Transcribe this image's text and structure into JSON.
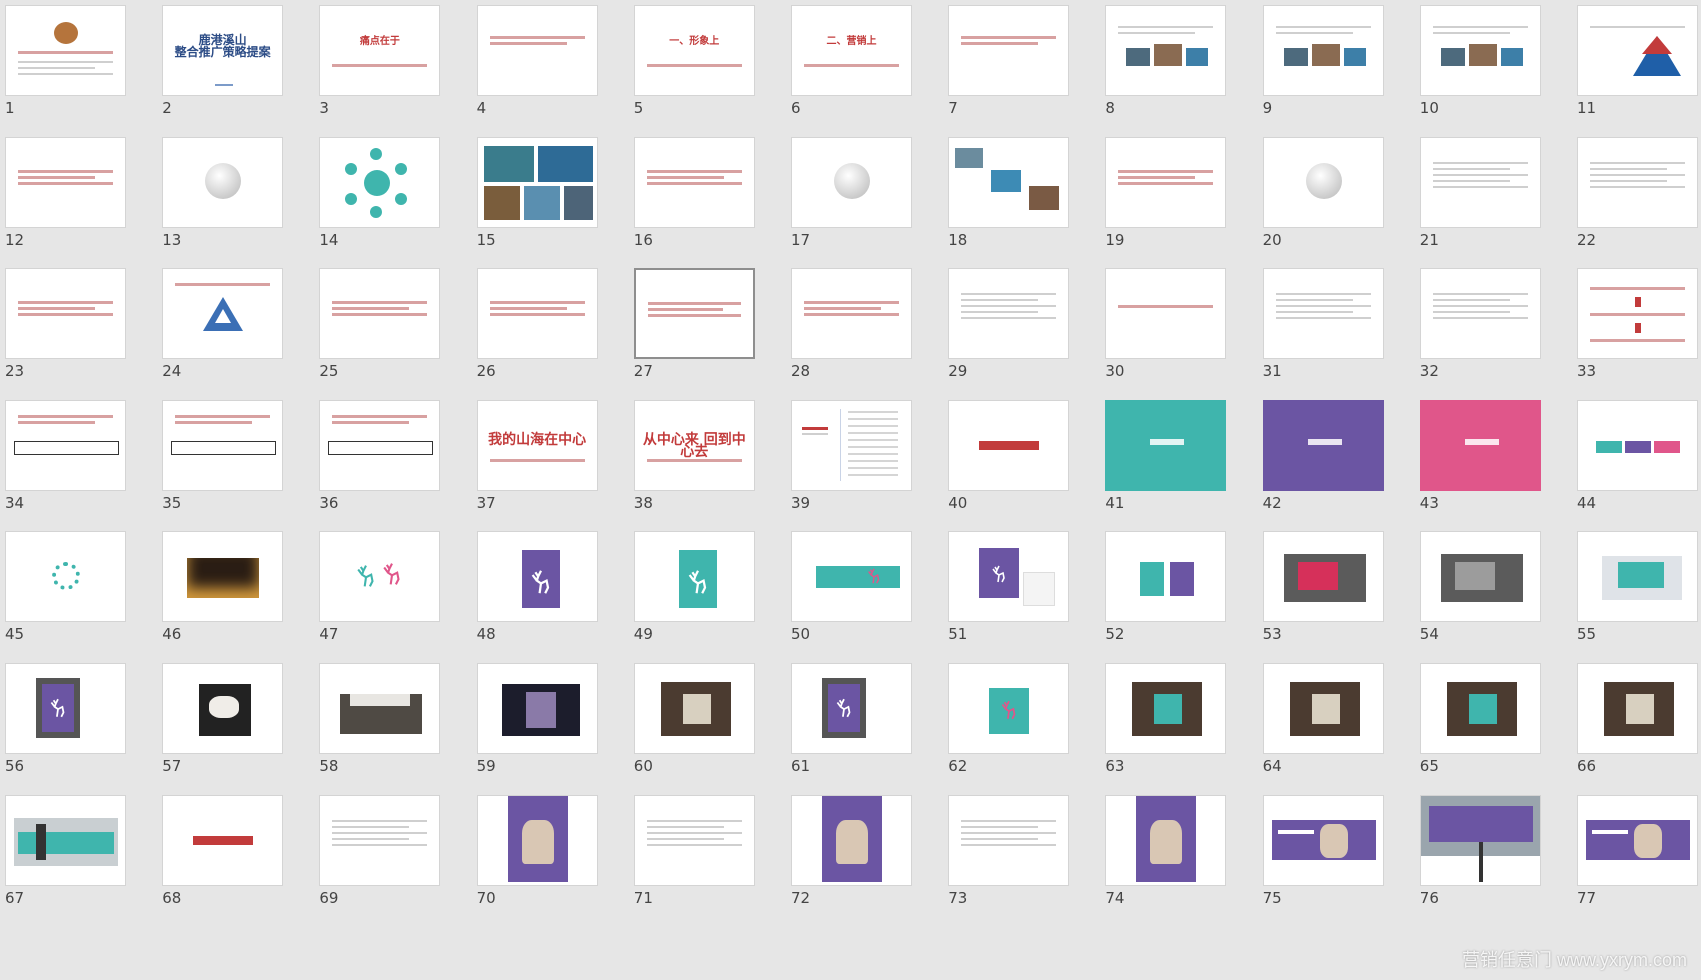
{
  "colors": {
    "background": "#e6e6e6",
    "accent_red": "#c23b3b",
    "teal": "#3fb5ad",
    "purple": "#6b55a3",
    "pink": "#e0568a",
    "selection_border": "#8e8e8e"
  },
  "slides": {
    "columns": 11,
    "selected": 27,
    "items": [
      {
        "n": 1,
        "kind": "logo"
      },
      {
        "n": 2,
        "kind": "title-navy",
        "title": "鹿港溪山\n整合推广策略提案"
      },
      {
        "n": 3,
        "kind": "title",
        "title": "痛点在于"
      },
      {
        "n": 4,
        "kind": "title"
      },
      {
        "n": 5,
        "kind": "title",
        "title": "一、形象上"
      },
      {
        "n": 6,
        "kind": "title",
        "title": "二、营销上"
      },
      {
        "n": 7,
        "kind": "title"
      },
      {
        "n": 8,
        "kind": "photos-text"
      },
      {
        "n": 9,
        "kind": "photos-text"
      },
      {
        "n": 10,
        "kind": "photos-text"
      },
      {
        "n": 11,
        "kind": "pyramid"
      },
      {
        "n": 12,
        "kind": "text-red"
      },
      {
        "n": 13,
        "kind": "circle-gray"
      },
      {
        "n": 14,
        "kind": "network"
      },
      {
        "n": 15,
        "kind": "photo-grid"
      },
      {
        "n": 16,
        "kind": "text-red"
      },
      {
        "n": 17,
        "kind": "circle-gray"
      },
      {
        "n": 18,
        "kind": "photo-scatter"
      },
      {
        "n": 19,
        "kind": "text-red"
      },
      {
        "n": 20,
        "kind": "circle-gray"
      },
      {
        "n": 21,
        "kind": "text-gray"
      },
      {
        "n": 22,
        "kind": "text-gray"
      },
      {
        "n": 23,
        "kind": "text-red"
      },
      {
        "n": 24,
        "kind": "triangle"
      },
      {
        "n": 25,
        "kind": "text-red"
      },
      {
        "n": 26,
        "kind": "text-red"
      },
      {
        "n": 27,
        "kind": "text-red"
      },
      {
        "n": 28,
        "kind": "text-red"
      },
      {
        "n": 29,
        "kind": "text-gray"
      },
      {
        "n": 30,
        "kind": "text-red-short"
      },
      {
        "n": 31,
        "kind": "text-gray"
      },
      {
        "n": 32,
        "kind": "text-gray"
      },
      {
        "n": 33,
        "kind": "arrows"
      },
      {
        "n": 34,
        "kind": "boxed"
      },
      {
        "n": 35,
        "kind": "boxed"
      },
      {
        "n": 36,
        "kind": "boxed"
      },
      {
        "n": 37,
        "kind": "title",
        "title": "我的山海在中心"
      },
      {
        "n": 38,
        "kind": "title",
        "title": "从中心来 回到中心去"
      },
      {
        "n": 39,
        "kind": "columns"
      },
      {
        "n": 40,
        "kind": "bar-red"
      },
      {
        "n": 41,
        "kind": "solid",
        "color": "#3fb5ad"
      },
      {
        "n": 42,
        "kind": "solid",
        "color": "#6b55a3"
      },
      {
        "n": 43,
        "kind": "solid",
        "color": "#e0568a"
      },
      {
        "n": 44,
        "kind": "swatches"
      },
      {
        "n": 45,
        "kind": "emblem"
      },
      {
        "n": 46,
        "kind": "photo-night"
      },
      {
        "n": 47,
        "kind": "deer-pair"
      },
      {
        "n": 48,
        "kind": "poster",
        "color": "#6b55a3"
      },
      {
        "n": 49,
        "kind": "poster",
        "color": "#3fb5ad"
      },
      {
        "n": 50,
        "kind": "banner",
        "color": "#3fb5ad"
      },
      {
        "n": 51,
        "kind": "stationery"
      },
      {
        "n": 52,
        "kind": "bags"
      },
      {
        "n": 53,
        "kind": "mock-dark"
      },
      {
        "n": 54,
        "kind": "mock-dark"
      },
      {
        "n": 55,
        "kind": "mock-light"
      },
      {
        "n": 56,
        "kind": "mock-poster"
      },
      {
        "n": 57,
        "kind": "mock-cup"
      },
      {
        "n": 58,
        "kind": "mock-book"
      },
      {
        "n": 59,
        "kind": "mock-window"
      },
      {
        "n": 60,
        "kind": "mock-photo"
      },
      {
        "n": 61,
        "kind": "mock-poster"
      },
      {
        "n": 62,
        "kind": "mock-sign"
      },
      {
        "n": 63,
        "kind": "mock-photo"
      },
      {
        "n": 64,
        "kind": "mock-photo"
      },
      {
        "n": 65,
        "kind": "mock-photo"
      },
      {
        "n": 66,
        "kind": "mock-photo"
      },
      {
        "n": 67,
        "kind": "mock-wall"
      },
      {
        "n": 68,
        "kind": "bar-red"
      },
      {
        "n": 69,
        "kind": "text-gray"
      },
      {
        "n": 70,
        "kind": "ad-purple"
      },
      {
        "n": 71,
        "kind": "text-gray"
      },
      {
        "n": 72,
        "kind": "ad-purple"
      },
      {
        "n": 73,
        "kind": "text-gray"
      },
      {
        "n": 74,
        "kind": "ad-purple"
      },
      {
        "n": 75,
        "kind": "ad-banner"
      },
      {
        "n": 76,
        "kind": "billboard"
      },
      {
        "n": 77,
        "kind": "ad-banner"
      }
    ]
  },
  "watermark": "营销任意门 www.yxrym.com"
}
